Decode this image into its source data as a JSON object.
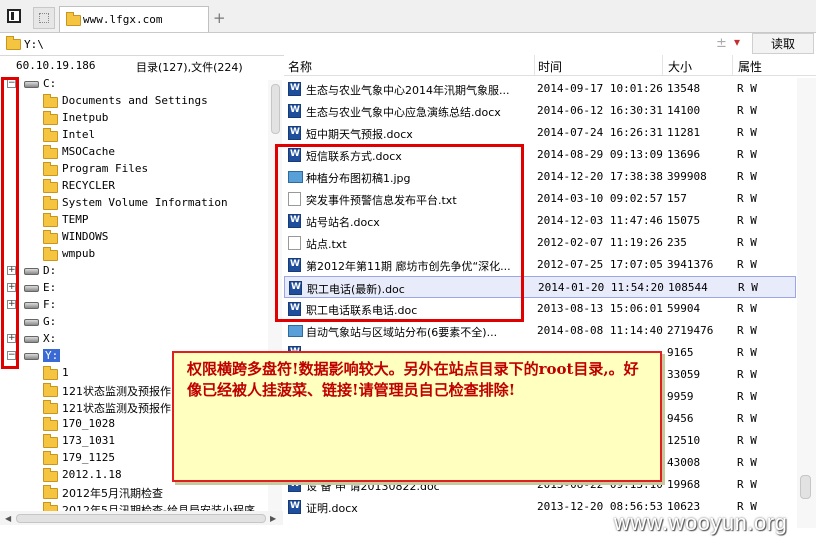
{
  "tab": {
    "title": "www.lfgx.com",
    "add_label": "+"
  },
  "address": {
    "path": "Y:\\",
    "plus_label": "±",
    "dropdown_label": "▾",
    "read_button": "读取"
  },
  "left_header": {
    "ip": "60.10.19.186",
    "counts": "目录(127),文件(224)"
  },
  "tree": {
    "drives": [
      {
        "label": "C:",
        "expander": "−"
      },
      {
        "label": "D:",
        "expander": "+"
      },
      {
        "label": "E:",
        "expander": "+"
      },
      {
        "label": "F:",
        "expander": "+"
      },
      {
        "label": "G:",
        "expander": ""
      },
      {
        "label": "X:",
        "expander": "+"
      },
      {
        "label": "Y:",
        "expander": "−"
      }
    ],
    "c_folders": [
      "Documents and Settings",
      "Inetpub",
      "Intel",
      "MSOCache",
      "Program Files",
      "RECYCLER",
      "System Volume Information",
      "TEMP",
      "WINDOWS",
      "wmpub"
    ],
    "y_folders": [
      "1",
      "121状态监测及预报作",
      "121状态监测及预报作",
      "170_1028",
      "173_1031",
      "179_1125",
      "2012.1.18",
      "2012年5月汛期检查",
      "2012年5月汛期检查-给县局安装小程序"
    ]
  },
  "list_header": {
    "name": "名称",
    "time": "时间",
    "size": "大小",
    "attr": "属性"
  },
  "files": [
    {
      "icon": "doc",
      "name": "生态与农业气象中心2014年汛期气象服...",
      "time": "2014-09-17 10:01:26",
      "size": "13548",
      "attr": "R W"
    },
    {
      "icon": "doc",
      "name": "生态与农业气象中心应急演练总结.docx",
      "time": "2014-06-12 16:30:31",
      "size": "14100",
      "attr": "R W"
    },
    {
      "icon": "doc",
      "name": "短中期天气预报.docx",
      "time": "2014-07-24 16:26:31",
      "size": "11281",
      "attr": "R W"
    },
    {
      "icon": "doc",
      "name": "短信联系方式.docx",
      "time": "2014-08-29 09:13:09",
      "size": "13696",
      "attr": "R W"
    },
    {
      "icon": "jpg",
      "name": "种植分布图初稿1.jpg",
      "time": "2014-12-20 17:38:38",
      "size": "399908",
      "attr": "R W"
    },
    {
      "icon": "txt",
      "name": "突发事件预警信息发布平台.txt",
      "time": "2014-03-10 09:02:57",
      "size": "157",
      "attr": "R W"
    },
    {
      "icon": "doc",
      "name": "站号站名.docx",
      "time": "2014-12-03 11:47:46",
      "size": "15075",
      "attr": "R W"
    },
    {
      "icon": "txt",
      "name": "站点.txt",
      "time": "2012-02-07 11:19:26",
      "size": "235",
      "attr": "R W"
    },
    {
      "icon": "doc",
      "name": "第2012年第11期 廊坊市创先争优“深化...",
      "time": "2012-07-25 17:07:05",
      "size": "3941376",
      "attr": "R W"
    },
    {
      "icon": "doc",
      "name": "职工电话(最新).doc",
      "time": "2014-01-20 11:54:20",
      "size": "108544",
      "attr": "R W"
    },
    {
      "icon": "doc",
      "name": "职工电话联系电话.doc",
      "time": "2013-08-13 15:06:01",
      "size": "59904",
      "attr": "R W"
    },
    {
      "icon": "jpg",
      "name": "自动气象站与区域站分布(6要素不全)...",
      "time": "2014-08-08 11:14:40",
      "size": "2719476",
      "attr": "R W"
    },
    {
      "icon": "doc",
      "name": "",
      "time": "",
      "size": "9165",
      "attr": "R W"
    },
    {
      "icon": "",
      "name": "",
      "time": "",
      "size": "33059",
      "attr": "R W"
    },
    {
      "icon": "",
      "name": "",
      "time": "",
      "size": "9959",
      "attr": "R W"
    },
    {
      "icon": "",
      "name": "",
      "time": "",
      "size": "9456",
      "attr": "R W"
    },
    {
      "icon": "",
      "name": "",
      "time": "",
      "size": "12510",
      "attr": "R W"
    },
    {
      "icon": "",
      "name": "",
      "time": "",
      "size": "43008",
      "attr": "R W"
    },
    {
      "icon": "doc",
      "name": "设 备 申 请20130822.doc",
      "time": "2013-08-22 09:13:10",
      "size": "19968",
      "attr": "R W"
    },
    {
      "icon": "doc",
      "name": "证明.docx",
      "time": "2013-12-20 08:56:53",
      "size": "10623",
      "attr": "R W"
    }
  ],
  "note": "权限横跨多盘符!数据影响较大。另外在站点目录下的root目录,。好像已经被人挂菠菜、链接!请管理员自己检查排除!",
  "watermark": "www.wooyun.org"
}
